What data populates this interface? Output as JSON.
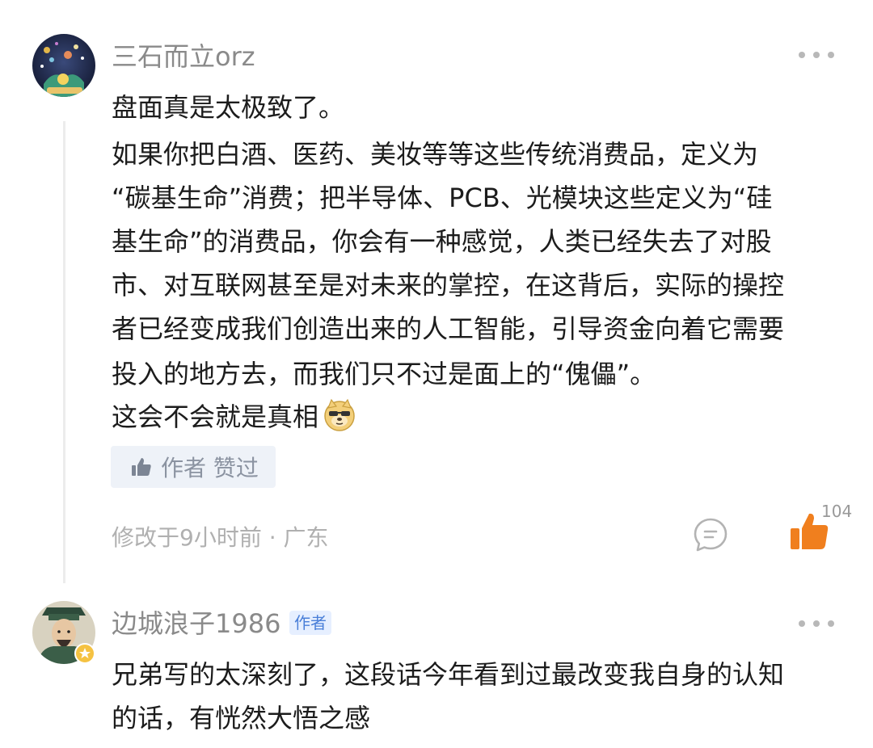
{
  "comments": [
    {
      "username": "三石而立orz",
      "body_lines": [
        "盘面真是太极致了。",
        "如果你把白酒、医药、美妆等等这些传统消费品，定义为",
        "“碳基生命”消费；把半导体、PCB、光模块这些定义为“硅",
        "基生命”的消费品，你会有一种感觉，人类已经失去了对股",
        "市、对互联网甚至是对未来的掌控，在这背后，实际的操控",
        "者已经变成我们创造出来的人工智能，引导资金向着它需要",
        "投入的地方去，而我们只不过是面上的“傀儡”。",
        "这会不会就是真相"
      ],
      "liked_by_author_label": "作者 赞过",
      "meta": "修改于9小时前 · 广东",
      "like_count": "104",
      "icons": {
        "avatar": "galaxy-avatar",
        "more": "more-dots-icon",
        "emoji": "doge-emoji-icon",
        "liked_thumb": "thumbs-up-icon",
        "reply": "reply-bubble-icon",
        "like": "thumbs-up-filled-icon"
      },
      "colors": {
        "like_accent": "#f07f1e"
      }
    },
    {
      "username": "边城浪子1986",
      "author_tag": "作者",
      "body_lines": [
        "兄弟写的太深刻了，这段话今年看到过最改变我自身的认知",
        "的话，有恍然大悟之感"
      ],
      "icons": {
        "avatar": "warrior-avatar",
        "badge": "gold-badge-icon",
        "more": "more-dots-icon"
      }
    }
  ]
}
